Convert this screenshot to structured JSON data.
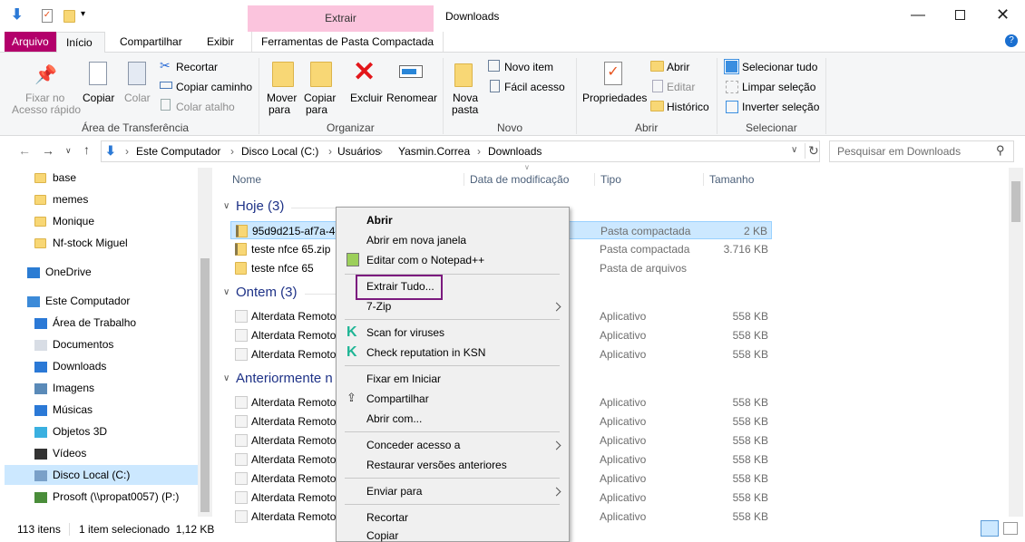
{
  "window": {
    "title": "Downloads",
    "context_tab": "Extrair",
    "context_color": "#fbc4dd"
  },
  "tabs": {
    "file": "Arquivo",
    "home": "Início",
    "share": "Compartilhar",
    "view": "Exibir",
    "tools": "Ferramentas de Pasta Compactada",
    "file_color": "#b3006b"
  },
  "ribbon": {
    "pin": "Fixar no",
    "pin2": "Acesso rápido",
    "copy": "Copiar",
    "paste": "Colar",
    "cut": "Recortar",
    "copy_path": "Copiar caminho",
    "paste_shortcut": "Colar atalho",
    "clipboard_group": "Área de Transferência",
    "move": "Mover",
    "move2": "para",
    "copyto": "Copiar",
    "copyto2": "para",
    "delete": "Excluir",
    "rename": "Renomear",
    "organize_group": "Organizar",
    "new_folder": "Nova",
    "new_folder2": "pasta",
    "new_item": "Novo item",
    "easy_access": "Fácil acesso",
    "new_group": "Novo",
    "properties": "Propriedades",
    "open": "Abrir",
    "edit": "Editar",
    "history": "Histórico",
    "open_group": "Abrir",
    "select_all": "Selecionar tudo",
    "select_none": "Limpar seleção",
    "invert": "Inverter seleção",
    "select_group": "Selecionar"
  },
  "address": {
    "crumbs": [
      "Este Computador",
      "Disco Local (C:)",
      "Usuários",
      "Yasmin.Correa",
      "Downloads"
    ],
    "search_placeholder": "Pesquisar em Downloads"
  },
  "sidebar": [
    "base",
    "memes",
    "Monique",
    "Nf-stock Miguel",
    "OneDrive",
    "Este Computador",
    "Área de Trabalho",
    "Documentos",
    "Downloads",
    "Imagens",
    "Músicas",
    "Objetos 3D",
    "Vídeos",
    "Disco Local (C:)",
    "Prosoft (\\\\propat0057) (P:)"
  ],
  "columns": {
    "name": "Nome",
    "date": "Data de modificação",
    "type": "Tipo",
    "size": "Tamanho"
  },
  "groups": [
    "Hoje (3)",
    "Ontem (3)",
    "Anteriormente n"
  ],
  "files_today": [
    {
      "name": "95d9d215-af7a-4e",
      "type": "Pasta compactada",
      "size": "2 KB"
    },
    {
      "name": "teste nfce 65.zip",
      "type": "Pasta compactada",
      "size": "3.716 KB"
    },
    {
      "name": "teste nfce 65",
      "type": "Pasta de arquivos",
      "size": ""
    }
  ],
  "files_yesterday": [
    {
      "name": "Alterdata Remoto",
      "type": "Aplicativo",
      "size": "558 KB"
    },
    {
      "name": "Alterdata Remoto",
      "type": "Aplicativo",
      "size": "558 KB"
    },
    {
      "name": "Alterdata Remoto",
      "type": "Aplicativo",
      "size": "558 KB"
    }
  ],
  "files_earlier": [
    {
      "name": "Alterdata Remoto",
      "type": "Aplicativo",
      "size": "558 KB"
    },
    {
      "name": "Alterdata Remoto",
      "type": "Aplicativo",
      "size": "558 KB"
    },
    {
      "name": "Alterdata Remoto",
      "type": "Aplicativo",
      "size": "558 KB"
    },
    {
      "name": "Alterdata Remoto",
      "type": "Aplicativo",
      "size": "558 KB"
    },
    {
      "name": "Alterdata Remoto",
      "type": "Aplicativo",
      "size": "558 KB"
    },
    {
      "name": "Alterdata Remoto",
      "type": "Aplicativo",
      "size": "558 KB"
    },
    {
      "name": "Alterdata Remoto",
      "type": "Aplicativo",
      "size": "558 KB"
    }
  ],
  "context_menu": {
    "open": "Abrir",
    "open_new": "Abrir em nova janela",
    "notepad": "Editar com o Notepad++",
    "extract": "Extrair Tudo...",
    "zip": "7-Zip",
    "scan": "Scan for viruses",
    "ksn": "Check reputation in KSN",
    "pin_start": "Fixar em Iniciar",
    "share": "Compartilhar",
    "open_with": "Abrir com...",
    "grant": "Conceder acesso a",
    "restore": "Restaurar versões anteriores",
    "send": "Enviar para",
    "cut": "Recortar",
    "copy": "Copiar",
    "highlight_color": "#7b1a7e"
  },
  "status": {
    "count": "113 itens",
    "selected": "1 item selecionado  1,12 KB"
  }
}
